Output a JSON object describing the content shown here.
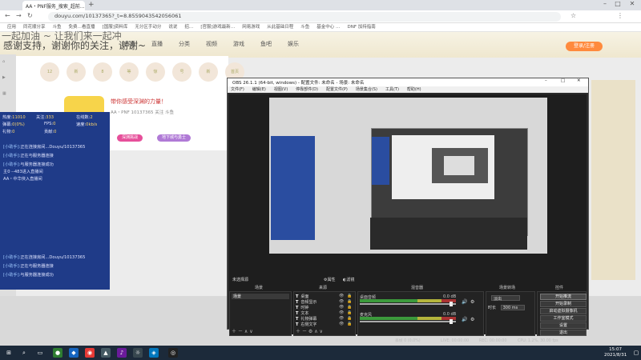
{
  "browser": {
    "tab_title": "AA・PNF服务_搜索_超前...",
    "tab_new": "+",
    "url": "douyu.com/10137365?_t=8.8559043542056061",
    "bookmarks": [
      "应用",
      "同花顺分享",
      "斗鱼",
      "免费…看直播",
      "[国服]资料库",
      "无分区手动分",
      "说说",
      "招…",
      "[官服]游戏最新…",
      "网易游戏",
      "从此基础日程",
      "斗鱼",
      "基金中心 …",
      "DNF 加持指南"
    ]
  },
  "site": {
    "overlay_line1": "一起加油 ~ 让我们来一起冲",
    "overlay_line2": "感谢支持，谢谢你的关注，谢谢~",
    "nav": [
      "首页",
      "直播",
      "分类",
      "视频",
      "游戏",
      "鱼吧",
      "娱乐"
    ],
    "login_button": "登录/注册",
    "icon_badges": [
      "12",
      "新",
      "8",
      "等",
      "惊",
      "号",
      "新",
      "首页"
    ],
    "stream_title": "带你感受深渊的力量！",
    "stream_sub": "AA・PNF  10137365  关注 斗鱼",
    "tag_1": "深渊挑战",
    "tag_2": "地下城与勇士"
  },
  "danmu": {
    "stats": [
      {
        "label": "热度",
        "value": "11010"
      },
      {
        "label": "关注",
        "value": "333"
      },
      {
        "label": "在线数",
        "value": "2"
      },
      {
        "label": "弹幕",
        "value": "0(0%)"
      },
      {
        "label": "FPS",
        "value": "0"
      },
      {
        "label": "速度",
        "value": "0kb/s"
      },
      {
        "label": "礼物",
        "value": "0"
      },
      {
        "label": "贡献",
        "value": "0"
      },
      {
        "label": "分享",
        "value": "0"
      }
    ],
    "messages": [
      {
        "who": "[小助手]:",
        "text": "正在连接房间...Douyu/10137365"
      },
      {
        "who": "[小助手]:",
        "text": "正在与服务器连接"
      },
      {
        "who": "[小助手]:",
        "text": "与服务器连接成功"
      },
      {
        "who": "",
        "text": "主0  --483进入直播间"
      },
      {
        "who": "",
        "text": "AA・中华侠入直播间"
      },
      {
        "who": "[小助手]:",
        "text": "正在连接房间...Douyu/10137365"
      },
      {
        "who": "[小助手]:",
        "text": "正在与服务器连接"
      },
      {
        "who": "[小助手]:",
        "text": "与服务器连接成功"
      }
    ]
  },
  "obs": {
    "title": "OBS 26.1.1 (64-bit, windows) - 配置文件: 未命名 - 场景: 未命名",
    "menu": [
      "文件(F)",
      "编辑(E)",
      "视图(V)",
      "停靠部件(D)",
      "配置文件(P)",
      "场景集合(S)",
      "工具(T)",
      "帮助(H)"
    ],
    "no_source": "未选择源",
    "properties_button": "属性",
    "filters_button": "滤镜",
    "docks": {
      "scenes": "场景",
      "sources": "来源",
      "mixer": "混音器",
      "transitions": "场景转场",
      "controls": "控件"
    },
    "scene_item": "场景",
    "sources": [
      "桌面",
      "音频显示",
      "时钟",
      "文本",
      "礼物弹幕",
      "右侧文字"
    ],
    "mixer_tracks": [
      {
        "name": "桌面音频",
        "db": "0.0 dB"
      },
      {
        "name": "麦克风",
        "db": "0.0 dB"
      }
    ],
    "transition_label": "淡出",
    "duration_label": "时长",
    "duration_value": "300 ms",
    "controls": [
      "开始推流",
      "开始录制",
      "启动虚拟摄像机",
      "工作室模式",
      "设置",
      "退出"
    ],
    "status": {
      "live": "LIVE: 00:00:00",
      "rec": "REC: 00:00:00",
      "cpu": "CPU: 1.2%, 30.00 fps",
      "dropped": "丢帧 0 (0.0%)"
    }
  },
  "taskbar": {
    "time": "15:07",
    "date": "2021/8/31"
  },
  "colors": {
    "danmu_bg": "#1f3b88",
    "obs_dark": "#2b2b2b",
    "accent_pink": "#e64f9a",
    "taskbar": "#1c2a3a"
  }
}
